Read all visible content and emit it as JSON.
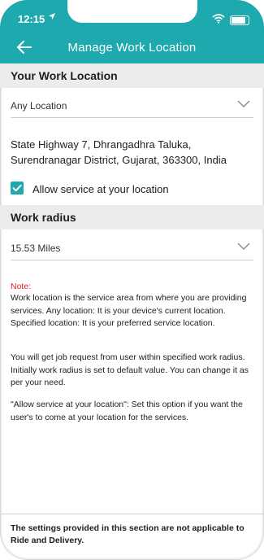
{
  "status_bar": {
    "time": "12:15"
  },
  "header": {
    "title": "Manage Work Location"
  },
  "work_location": {
    "section_title": "Your Work Location",
    "location_select_value": "Any Location",
    "address_line1": "State Highway 7, Dhrangadhra Taluka,",
    "address_line2": "Surendranagar District, Gujarat, 363300, India",
    "allow_service_label": "Allow service at your location",
    "allow_service_checked": true
  },
  "work_radius": {
    "section_title": "Work radius",
    "radius_select_value": "15.53 Miles"
  },
  "note": {
    "title": "Note:",
    "paragraph1": "Work location is the service area from where you are providing services. Any location: It is your device's current location. Specified location: It is your preferred service location.",
    "paragraph2": "You will get job request from user within specified work radius. Initially work radius is set to default value. You can change it as per your need.",
    "paragraph3": "\"Allow service at your location\": Set this option if you want the user's to come at your location for the services."
  },
  "footer": {
    "text": "The settings provided in this section are not applicable to Ride and Delivery."
  },
  "colors": {
    "accent": "#1ea9ae",
    "section_bg": "#ececec",
    "note_title": "#e11d1d"
  }
}
